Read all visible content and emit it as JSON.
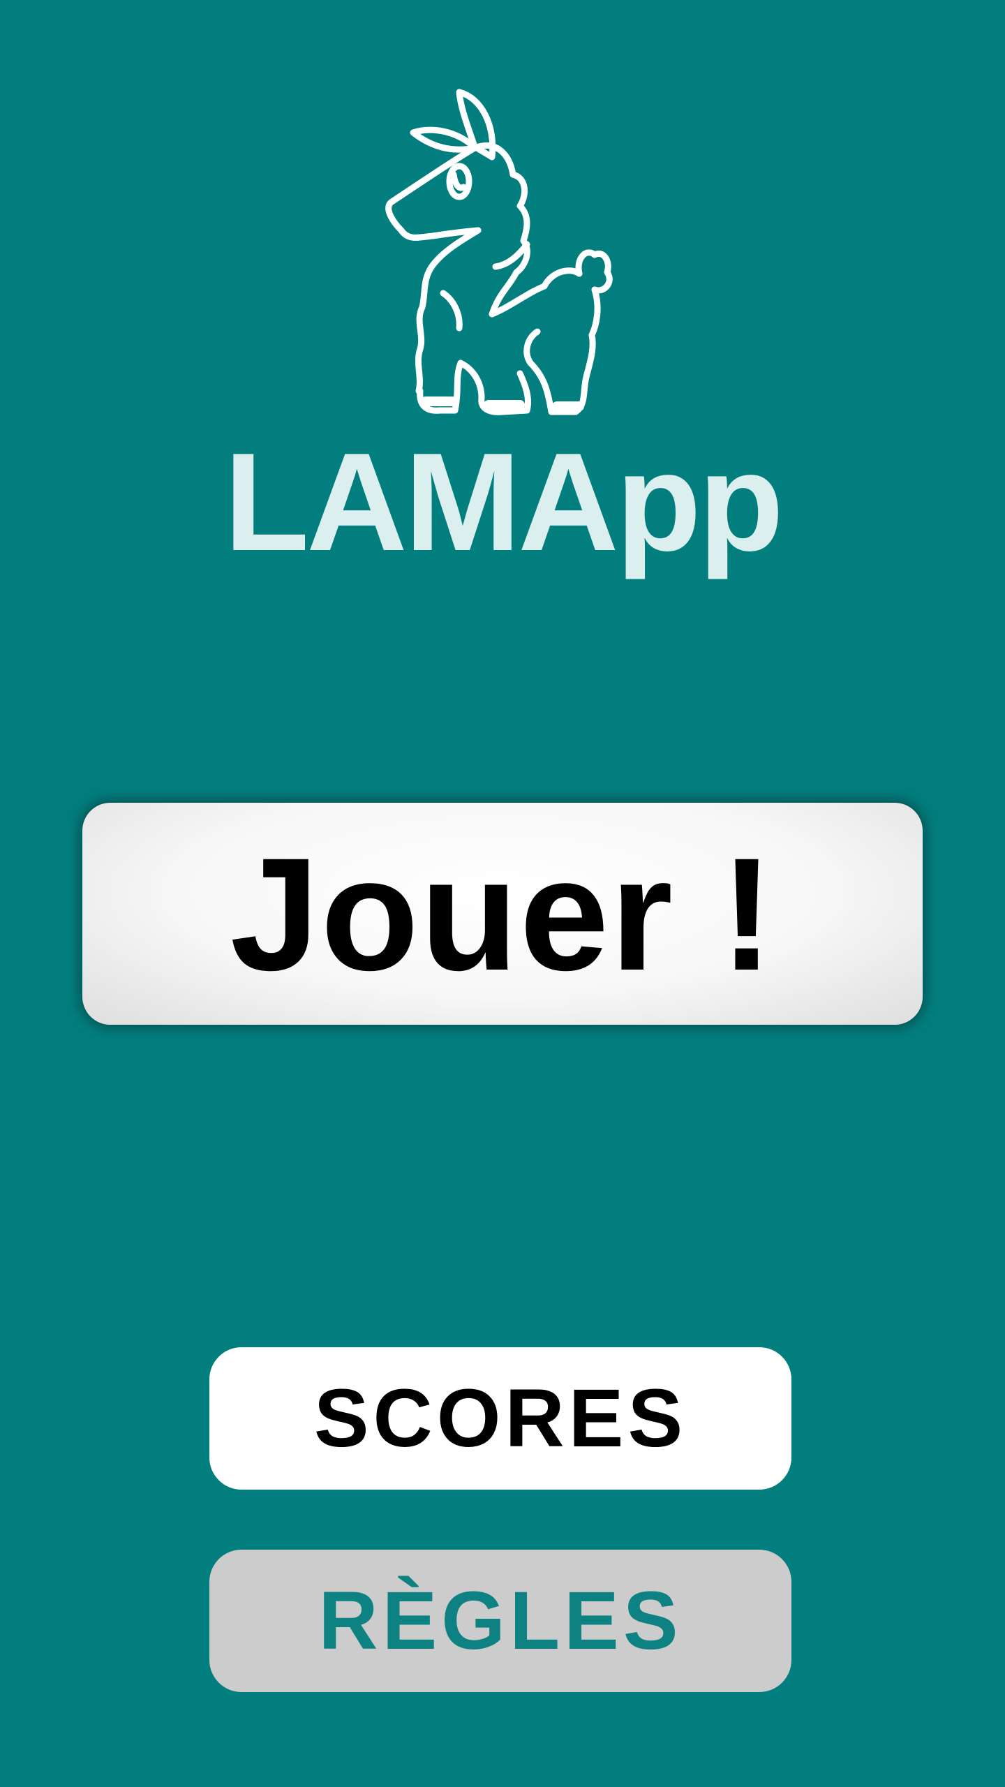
{
  "app": {
    "title": "LAMApp",
    "logo_icon": "llama-icon"
  },
  "colors": {
    "background": "#037e7e",
    "title": "#dcefef",
    "play_button": "#f5f5f5",
    "scores_button": "#ffffff",
    "rules_button": "#cccccc",
    "rules_text": "#0e8282"
  },
  "buttons": {
    "play_label": "Jouer !",
    "scores_label": "SCORES",
    "rules_label": "RÈGLES"
  }
}
